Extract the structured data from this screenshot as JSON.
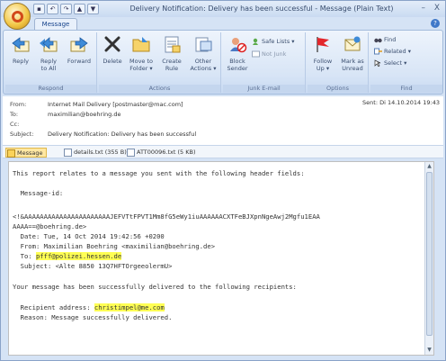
{
  "titlebar": {
    "title": "Delivery Notification: Delivery has been successful - Message (Plain Text)",
    "min": "–",
    "close": "X"
  },
  "tabs": {
    "message": "Message"
  },
  "ribbon": {
    "respond": {
      "label": "Respond",
      "reply": "Reply",
      "reply_all_1": "Reply",
      "reply_all_2": "to All",
      "forward": "Forward"
    },
    "actions": {
      "label": "Actions",
      "delete": "Delete",
      "move_1": "Move to",
      "move_2": "Folder ▾",
      "rule_1": "Create",
      "rule_2": "Rule",
      "other_1": "Other",
      "other_2": "Actions ▾"
    },
    "junk": {
      "label": "Junk E-mail",
      "block_1": "Block",
      "block_2": "Sender",
      "safe_lists": "Safe Lists ▾",
      "not_junk": "Not Junk"
    },
    "options": {
      "label": "Options",
      "followup_1": "Follow",
      "followup_2": "Up ▾",
      "mark_1": "Mark as",
      "mark_2": "Unread"
    },
    "find": {
      "label": "Find",
      "find": "Find",
      "related": "Related ▾",
      "select": "Select ▾"
    }
  },
  "header": {
    "from_label": "From:",
    "from_value": "Internet Mail Delivery [postmaster@mac.com]",
    "to_label": "To:",
    "to_value": "maximilian@boehring.de",
    "cc_label": "Cc:",
    "cc_value": "",
    "subject_label": "Subject:",
    "subject_value": "Delivery Notification: Delivery has been successful",
    "sent": "Sent: Di 14.10.2014 19:43"
  },
  "attachments": {
    "message": "Message",
    "details": "details.txt (355 B)",
    "att": "ATT00096.txt (5 KB)"
  },
  "body": {
    "l1": "This report relates to a message you sent with the following header fields:",
    "l2": "  Message-id:",
    "l3": "<!&AAAAAAAAAAAAAAAAAAAAAAJEFVTtFPVT1Mm8fG5eWy1iuAAAAAACXTFeBJXpnNgeAwj2Mgfu1EAA",
    "l4": "AAAA==@boehring.de>",
    "l5": "  Date: Tue, 14 Oct 2014 19:42:56 +0200",
    "l6": "  From: Maximilian Boehring <maximilian@boehring.de>",
    "l7_pre": "  To: ",
    "l7_hl": "pfff@polizei.hessen.de",
    "l8": "  Subject: <Alte 8850 13Q7HFTOrgeeolermU>",
    "l9": "Your message has been successfully delivered to the following recipients:",
    "l10_pre": "  Recipient address: ",
    "l10_hl": "christimpel@me.com",
    "l11": "  Reason: Message successfully delivered."
  }
}
